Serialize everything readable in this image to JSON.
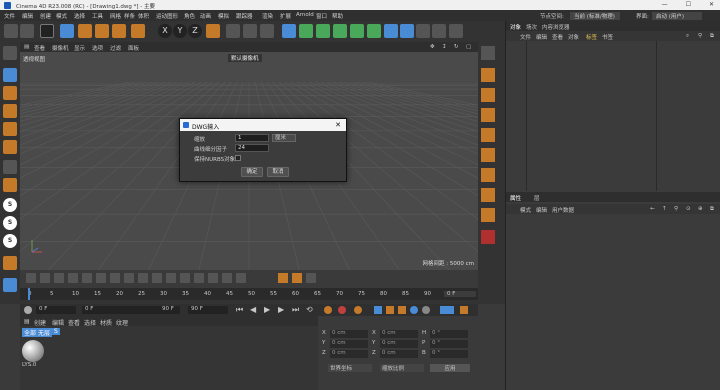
{
  "window": {
    "title": "Cinema 4D R23.008 (RC) - [Drawing1.dwg *] - 主要"
  },
  "menu": [
    "文件",
    "编辑",
    "创建",
    "模式",
    "选择",
    "工具",
    "网格",
    "样条",
    "体积",
    "运动图形",
    "角色",
    "动画",
    "模拟",
    "跟踪器",
    "渲染",
    "扩展",
    "Arnold",
    "窗口",
    "帮助"
  ],
  "layout_label": "界面:",
  "layout_value": "启动 (用户)",
  "node_label": "节点空间:",
  "node_value": "当前 (标准/物理)",
  "axes_buttons": [
    "X",
    "Y",
    "Z"
  ],
  "viewport": {
    "menu": [
      "查看",
      "摄像机",
      "显示",
      "选项",
      "过滤",
      "面板"
    ],
    "label": "透视视图",
    "camera": "默认摄像机",
    "grid_info": "网格间距 : 5000 cm"
  },
  "dialog": {
    "title": "DWG输入",
    "scale_label": "缩放",
    "scale_value": "1",
    "unit_value": "厘米",
    "subdiv_label": "曲线细分因子",
    "subdiv_value": "24",
    "nurbs_label": "保持NURBS对象",
    "ok": "确定",
    "cancel": "取消"
  },
  "objects_panel": {
    "tabs": [
      "对象",
      "场次",
      "内容浏览器"
    ],
    "menu": [
      "文件",
      "编辑",
      "查看",
      "对象",
      "标签",
      "书签"
    ]
  },
  "attributes_panel": {
    "tabs": [
      "属性",
      "层"
    ],
    "menu": [
      "模式",
      "编辑",
      "用户数据"
    ]
  },
  "timeline": {
    "ticks": [
      "0",
      "5",
      "10",
      "15",
      "20",
      "25",
      "30",
      "35",
      "40",
      "45",
      "50",
      "55",
      "60",
      "65",
      "70",
      "75",
      "80",
      "85",
      "90"
    ],
    "frame_end_marker": "0 F",
    "current_frame": "0 F",
    "start_field": "0 F",
    "end_field": "90 F",
    "end_field2": "90 F"
  },
  "material_panel": {
    "menu": [
      "创建",
      "编辑",
      "查看",
      "选择",
      "材质",
      "纹理"
    ],
    "filter_all": "全部",
    "filter_none": "无层",
    "filter_ext": "S",
    "material_name": "LYS.0"
  },
  "coords_panel": {
    "rows": [
      {
        "a": "X",
        "av": "0 cm",
        "b": "X",
        "bv": "0 cm",
        "c": "H",
        "cv": "0 °"
      },
      {
        "a": "Y",
        "av": "0 cm",
        "b": "Y",
        "bv": "0 cm",
        "c": "P",
        "cv": "0 °"
      },
      {
        "a": "Z",
        "av": "0 cm",
        "b": "Z",
        "bv": "0 cm",
        "c": "B",
        "cv": "0 °"
      }
    ],
    "space": "世界坐标",
    "mode": "缩放比例",
    "apply": "应用"
  },
  "colors": {
    "accent": "#4a8bd6",
    "orange": "#c47a28"
  }
}
